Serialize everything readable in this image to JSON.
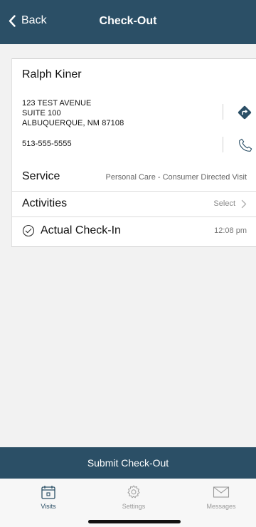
{
  "nav": {
    "back_label": "Back",
    "title": "Check-Out"
  },
  "patient": {
    "name": "Ralph Kiner",
    "address_line1": "123 TEST AVENUE",
    "address_line2": "SUITE 100",
    "address_line3": "ALBUQUERQUE, NM 87108",
    "phone": "513-555-5555"
  },
  "service": {
    "label": "Service",
    "value": "Personal Care - Consumer Directed Visit"
  },
  "activities": {
    "label": "Activities",
    "value": "Select"
  },
  "checkin": {
    "label": "Actual Check-In",
    "time": "12:08 pm"
  },
  "submit_label": "Submit Check-Out",
  "tabs": [
    {
      "label": "Visits",
      "icon": "calendar-icon",
      "active": true
    },
    {
      "label": "Settings",
      "icon": "gear-icon",
      "active": false
    },
    {
      "label": "Messages",
      "icon": "envelope-icon",
      "active": false
    }
  ],
  "colors": {
    "nav": "#2b4f66",
    "accent": "#2b4f66",
    "inactive": "#9a9a9a"
  }
}
